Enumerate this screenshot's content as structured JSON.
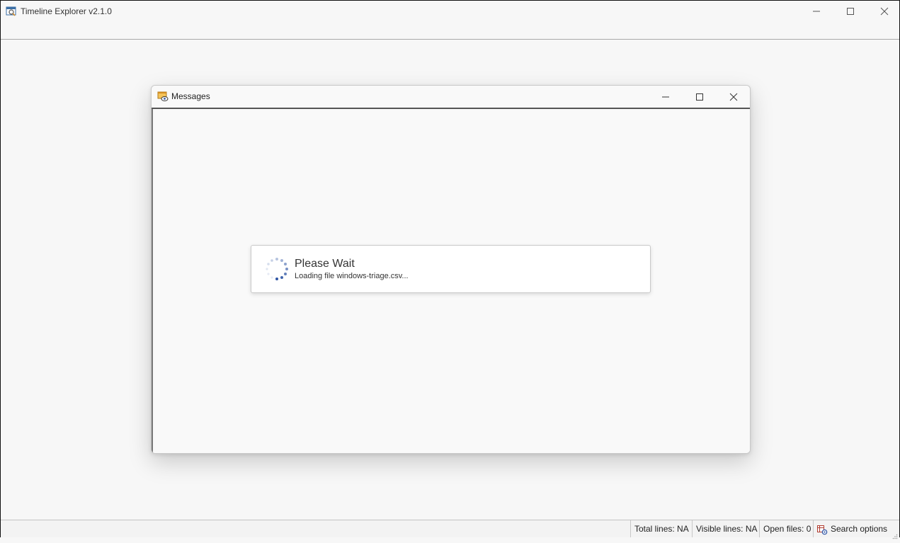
{
  "app": {
    "title": "Timeline Explorer v2.1.0",
    "icon": "timeline-explorer-app-icon"
  },
  "window_controls": {
    "minimize_icon": "minimize-icon",
    "maximize_icon": "maximize-icon",
    "close_icon": "close-icon"
  },
  "dialog": {
    "title": "Messages",
    "icon": "messages-icon"
  },
  "wait": {
    "title": "Please Wait",
    "message": "Loading file windows-triage.csv..."
  },
  "status_bar": {
    "total_lines": "Total lines: NA",
    "visible_lines": "Visible lines: NA",
    "open_files": "Open files: 0",
    "search_options": "Search options",
    "search_icon": "search-options-icon"
  },
  "colors": {
    "background": "#f7f7f7",
    "spinner": "#2f55a4"
  }
}
